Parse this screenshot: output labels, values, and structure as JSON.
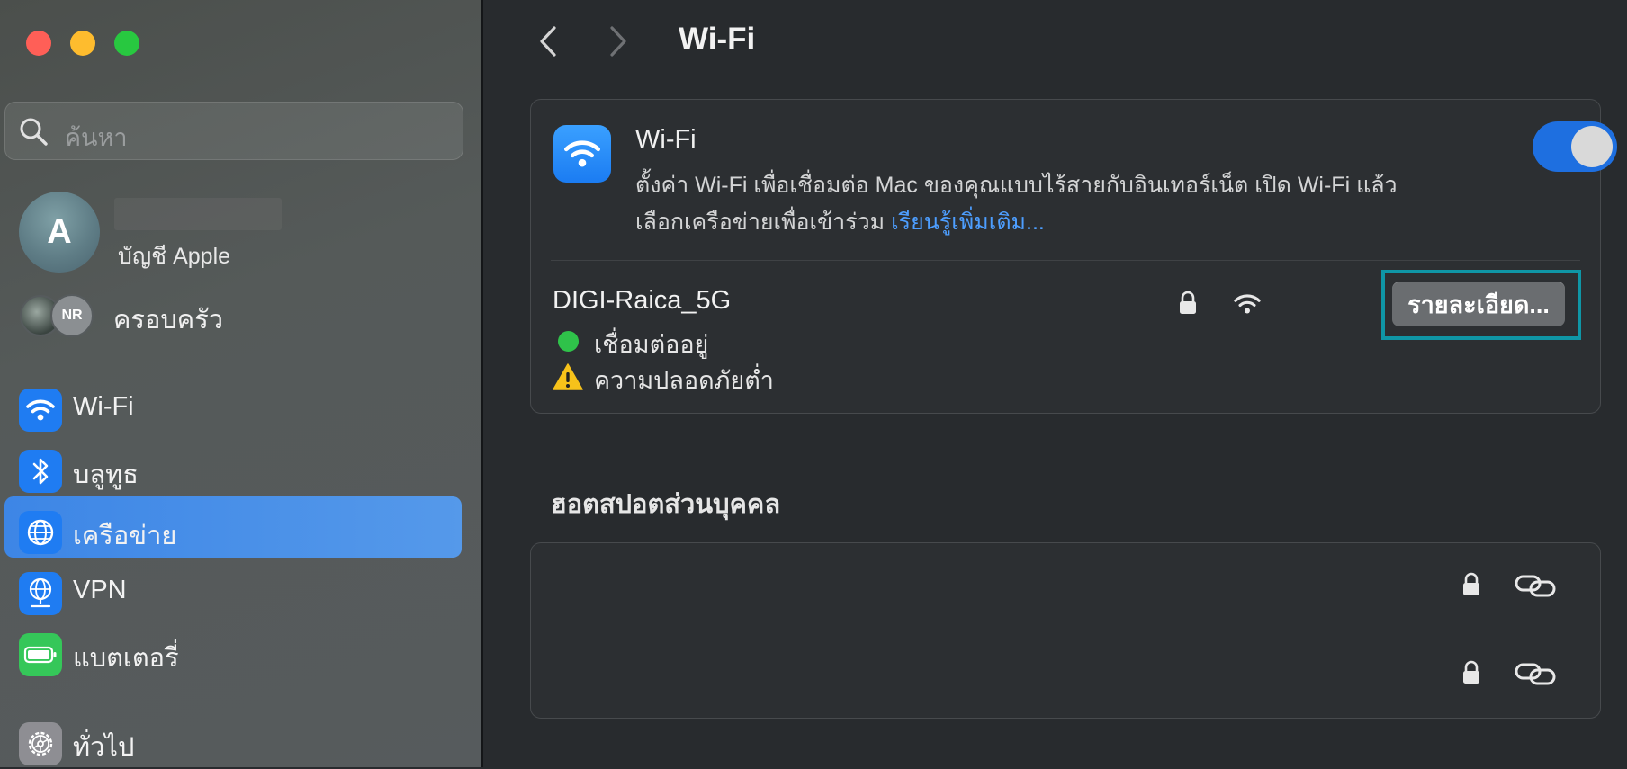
{
  "sidebar": {
    "search_placeholder": "ค้นหา",
    "account": {
      "avatar_initial": "A",
      "subtitle": "บัญชี Apple"
    },
    "family": {
      "avatar_initials": "NR",
      "label": "ครอบครัว"
    },
    "items": [
      {
        "label": "Wi-Fi",
        "icon": "wifi-icon",
        "color": "#1f7cf2"
      },
      {
        "label": "บลูทูธ",
        "icon": "bluetooth-icon",
        "color": "#1f7cf2"
      },
      {
        "label": "เครือข่าย",
        "icon": "globe-icon",
        "color": "#1f7cf2",
        "selected": true
      },
      {
        "label": "VPN",
        "icon": "vpn-globe-icon",
        "color": "#1f7cf2"
      },
      {
        "label": "แบตเตอรี่",
        "icon": "battery-icon",
        "color": "#35c759"
      },
      {
        "label": "ทั่วไป",
        "icon": "gear-icon",
        "color": "#8e8e93"
      }
    ]
  },
  "header": {
    "title": "Wi-Fi"
  },
  "wifi_card": {
    "title": "Wi-Fi",
    "description": "ตั้งค่า Wi-Fi เพื่อเชื่อมต่อ Mac ของคุณแบบไร้สายกับอินเทอร์เน็ต เปิด Wi-Fi แล้ว เลือกเครือข่ายเพื่อเข้าร่วม",
    "learn_more": "เรียนรู้เพิ่มเติม...",
    "enabled": true,
    "network": {
      "name": "DIGI-Raica_5G",
      "status": "เชื่อมต่ออยู่",
      "warning": "ความปลอดภัยต่ำ",
      "details_button": "รายละเอียด..."
    }
  },
  "hotspot": {
    "title": "ฮอตสปอตส่วนบุคคล",
    "rows": [
      {
        "name": "",
        "locked": true
      },
      {
        "name": "",
        "locked": true
      }
    ]
  },
  "colors": {
    "accent": "#1e6fe0",
    "selected_sidebar": "#3d86e6",
    "link": "#4d9eff",
    "connected": "#2fc24a",
    "highlight_border": "#0f96a6"
  }
}
